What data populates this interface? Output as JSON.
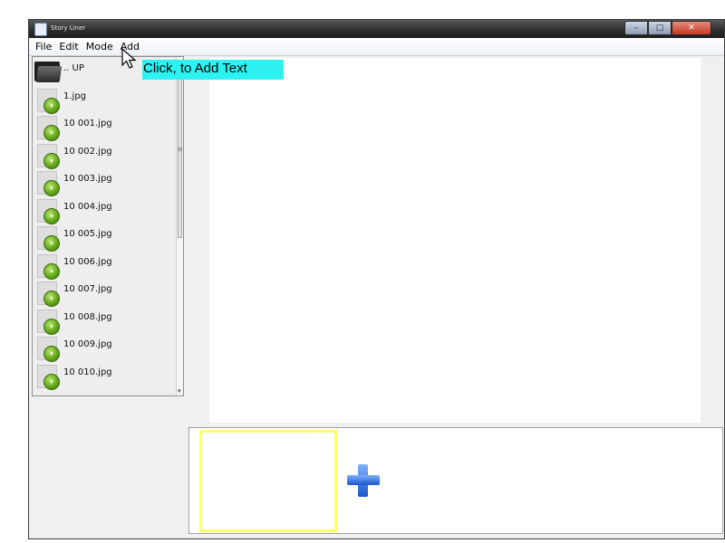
{
  "window": {
    "title": "Story Liner",
    "controls": {
      "minimize": "–",
      "maximize": "□",
      "close": "✕"
    }
  },
  "menu": [
    "File",
    "Edit",
    "Mode",
    "Add"
  ],
  "file_list": {
    "up_label": ".. UP",
    "files": [
      "1.jpg",
      "10 001.jpg",
      "10 002.jpg",
      "10 003.jpg",
      "10 004.jpg",
      "10 005.jpg",
      "10 006.jpg",
      "10 007.jpg",
      "10 008.jpg",
      "10 009.jpg",
      "10 010.jpg"
    ]
  },
  "tooltip": {
    "text": "Click, to Add Text",
    "color": "#2ef2f2"
  },
  "colors": {
    "slide_border": "#ffff66",
    "add_icon": "#1a56c9"
  },
  "icons": {
    "folder": "folder-up-icon",
    "image": "image-file-icon",
    "add": "plus-icon"
  }
}
